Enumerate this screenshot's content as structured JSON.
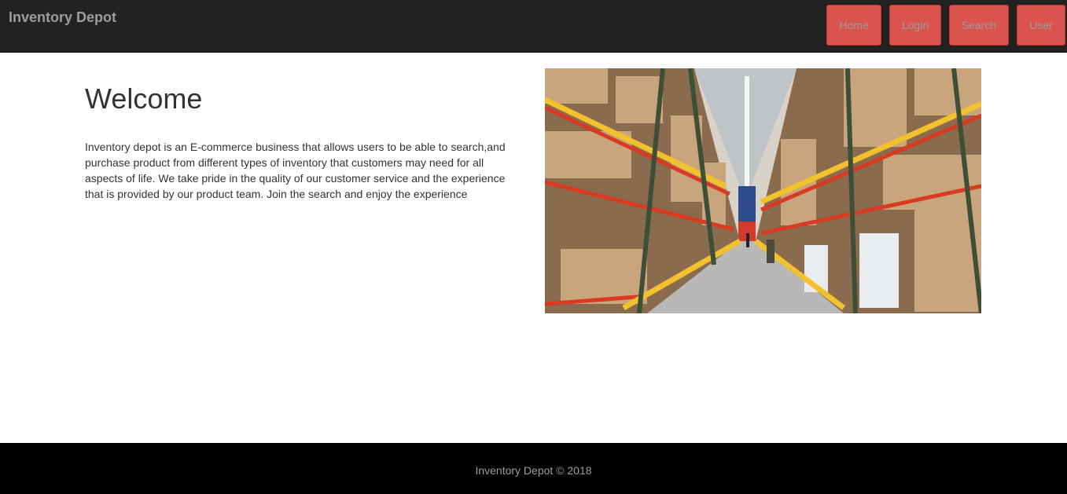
{
  "navbar": {
    "brand": "Inventory Depot",
    "buttons": [
      {
        "label": "Home"
      },
      {
        "label": "Login"
      },
      {
        "label": "Search"
      },
      {
        "label": "User"
      }
    ]
  },
  "main": {
    "title": "Welcome",
    "intro": "Inventory depot is an E-commerce business that allows users to be able to search,and purchase product from different types of inventory that customers may need for all aspects of life. We take pride in the quality of our customer service and the experience that is provided by our product team. Join the search and enjoy the experience",
    "image": {
      "subject": "warehouse-aisle-image"
    }
  },
  "footer": {
    "text": "Inventory Depot © 2018"
  },
  "colors": {
    "navbar_bg": "#222222",
    "button_bg": "#d9534f",
    "footer_bg": "#000000",
    "muted_text": "#9d9d9d"
  }
}
